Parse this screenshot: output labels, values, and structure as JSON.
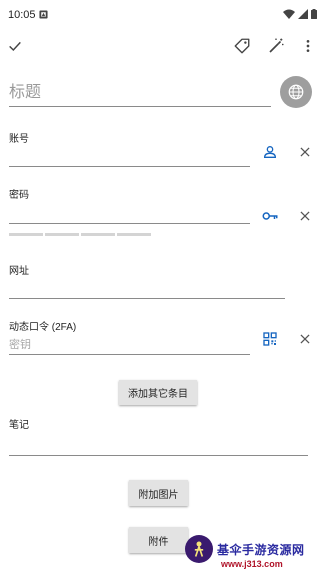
{
  "status": {
    "time": "10:05"
  },
  "title": {
    "placeholder": "标题"
  },
  "account": {
    "label": "账号"
  },
  "password": {
    "label": "密码"
  },
  "url": {
    "label": "网址"
  },
  "totp": {
    "label": "动态口令 (2FA)",
    "placeholder": "密钥"
  },
  "add_field_button": "添加其它条目",
  "notes": {
    "label": "笔记"
  },
  "attach_image_button": "附加图片",
  "attachment_button": "附件",
  "watermark": {
    "title": "基伞手游资源网",
    "url": "www.j313.com"
  },
  "colors": {
    "accent": "#1565c0",
    "icon_gray": "#555555",
    "globe_bg": "#9e9e9e",
    "button_bg": "#e3e3e3"
  },
  "icons": [
    "check-icon",
    "tag-icon",
    "magic-wand-icon",
    "more-vert-icon",
    "globe-icon",
    "person-icon",
    "key-icon",
    "qr-code-icon",
    "close-icon"
  ]
}
